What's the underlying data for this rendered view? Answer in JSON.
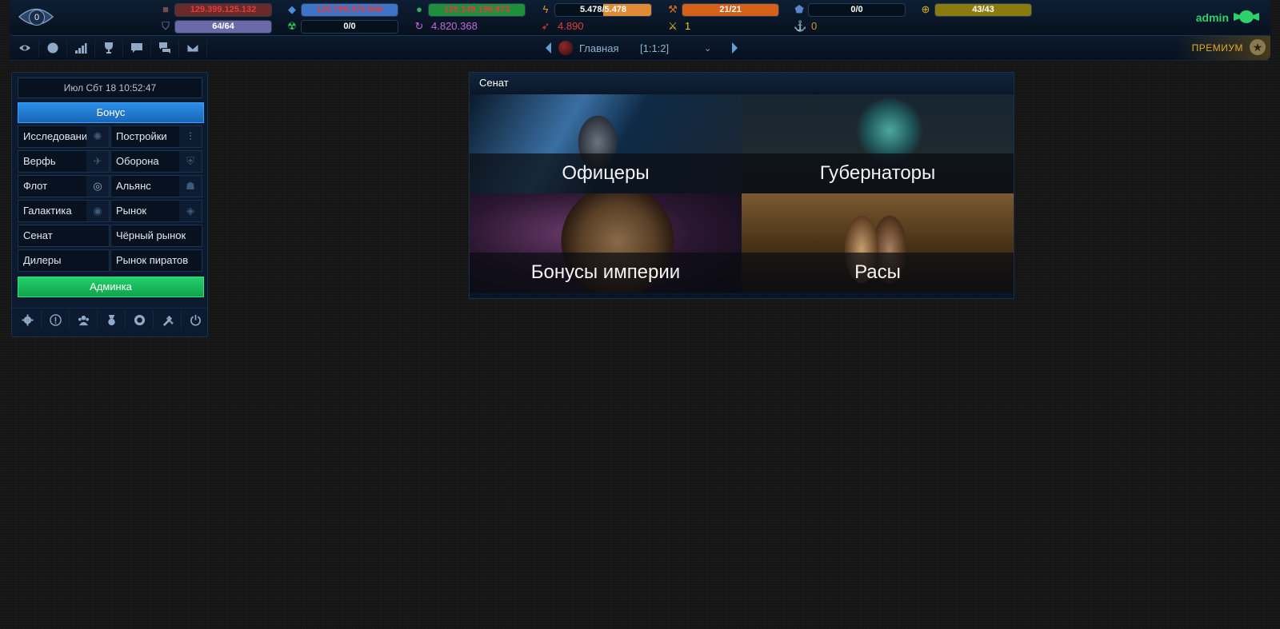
{
  "header": {
    "notification_count": "0",
    "user": "admin",
    "resources_row1": [
      {
        "icon": "metal-icon",
        "value": "129.399.125.132",
        "fill": 1.0,
        "color": "#6a2a2a",
        "text_color": "#e23c3c"
      },
      {
        "icon": "crystal-icon",
        "value": "120.799.370.556",
        "fill": 1.0,
        "color": "#3f73c6",
        "text_color": "#e23c3c"
      },
      {
        "icon": "deuterium-icon",
        "value": "125.149.198.873",
        "fill": 1.0,
        "color": "#1e8f3c",
        "text_color": "#e23c3c"
      },
      {
        "icon": "energy-icon",
        "value": "5.478/5.478",
        "fill": 0.5,
        "color": "#e08a35",
        "text_color": "#ffffff"
      },
      {
        "icon": "hammer-icon",
        "value": "21/21",
        "fill": 1.0,
        "color": "#d4601a",
        "text_color": "#ffffff"
      },
      {
        "icon": "moon-badge-icon",
        "value": "0/0",
        "fill": 0.0,
        "color": "#2b4a7a",
        "text_color": "#ffffff"
      },
      {
        "icon": "target-icon",
        "value": "43/43",
        "fill": 1.0,
        "color": "#8a7a10",
        "text_color": "#ffffff"
      }
    ],
    "resources_row2": [
      {
        "icon": "shield-icon",
        "value": "64/64",
        "type": "bar",
        "fill": 1.0,
        "color": "#6a6aa8",
        "text_color": "#ffffff"
      },
      {
        "icon": "radiation-icon",
        "value": "0/0",
        "type": "bar",
        "fill": 0.0,
        "color": "#1e8f3c",
        "text_color": "#ffffff"
      },
      {
        "icon": "recycle-icon",
        "value": "4.820.368",
        "type": "plain",
        "text_color": "#c06ad8"
      },
      {
        "icon": "rocket-icon",
        "value": "4.890",
        "type": "plain",
        "text_color": "#e23c3c"
      },
      {
        "icon": "swords-icon",
        "value": "1",
        "type": "plain",
        "text_color": "#e8d020"
      },
      {
        "icon": "anchor-icon",
        "value": "0",
        "type": "plain",
        "text_color": "#c89a2a"
      }
    ]
  },
  "navbar": {
    "planet_name": "Главная",
    "planet_coords": "[1:1:2]",
    "premium_label": "ПРЕМИУМ"
  },
  "sidebar": {
    "datetime": "Июл Сбт 18 10:52:47",
    "bonus_label": "Бонус",
    "items": [
      {
        "label": "Исследовани",
        "icon": "atom-icon"
      },
      {
        "label": "Постройки",
        "icon": "sliders-icon"
      },
      {
        "label": "Верфь",
        "icon": "ship-icon"
      },
      {
        "label": "Оборона",
        "icon": "defense-icon"
      },
      {
        "label": "Флот",
        "icon": "fleet-icon"
      },
      {
        "label": "Альянс",
        "icon": "alliance-icon"
      },
      {
        "label": "Галактика",
        "icon": "galaxy-icon"
      },
      {
        "label": "Рынок",
        "icon": "tag-icon"
      },
      {
        "label": "Сенат",
        "icon": ""
      },
      {
        "label": "Чёрный рынок",
        "icon": ""
      },
      {
        "label": "Дилеры",
        "icon": ""
      },
      {
        "label": "Рынок пиратов",
        "icon": ""
      }
    ],
    "admin_label": "Админка"
  },
  "senate": {
    "title": "Сенат",
    "tiles": [
      {
        "label": "Офицеры"
      },
      {
        "label": "Губернаторы"
      },
      {
        "label": "Бонусы империи"
      },
      {
        "label": "Расы"
      }
    ]
  }
}
